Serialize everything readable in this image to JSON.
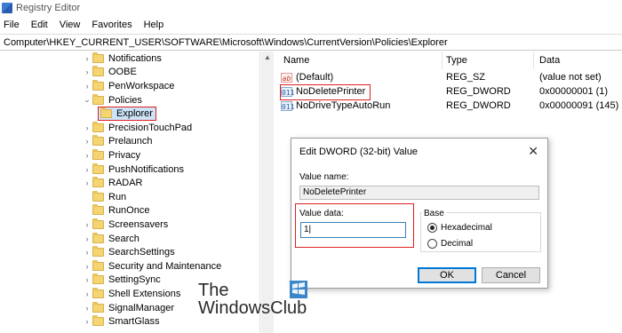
{
  "window": {
    "title": "Registry Editor"
  },
  "menu": [
    "File",
    "Edit",
    "View",
    "Favorites",
    "Help"
  ],
  "address": "Computer\\HKEY_CURRENT_USER\\SOFTWARE\\Microsoft\\Windows\\CurrentVersion\\Policies\\Explorer",
  "tree": {
    "items": [
      {
        "label": "Notifications",
        "chevron": "›"
      },
      {
        "label": "OOBE",
        "chevron": "›"
      },
      {
        "label": "PenWorkspace",
        "chevron": "›"
      },
      {
        "label": "Policies",
        "chevron": "⌄"
      },
      {
        "label": "Explorer",
        "chevron": ""
      },
      {
        "label": "PrecisionTouchPad",
        "chevron": "›"
      },
      {
        "label": "Prelaunch",
        "chevron": "›"
      },
      {
        "label": "Privacy",
        "chevron": "›"
      },
      {
        "label": "PushNotifications",
        "chevron": "›"
      },
      {
        "label": "RADAR",
        "chevron": "›"
      },
      {
        "label": "Run",
        "chevron": ""
      },
      {
        "label": "RunOnce",
        "chevron": ""
      },
      {
        "label": "Screensavers",
        "chevron": "›"
      },
      {
        "label": "Search",
        "chevron": "›"
      },
      {
        "label": "SearchSettings",
        "chevron": "›"
      },
      {
        "label": "Security and Maintenance",
        "chevron": "›"
      },
      {
        "label": "SettingSync",
        "chevron": "›"
      },
      {
        "label": "Shell Extensions",
        "chevron": "›"
      },
      {
        "label": "SignalManager",
        "chevron": "›"
      },
      {
        "label": "SmartGlass",
        "chevron": "›"
      }
    ]
  },
  "list": {
    "headers": {
      "name": "Name",
      "type": "Type",
      "data": "Data"
    },
    "rows": [
      {
        "icon": "ab",
        "name": "(Default)",
        "type": "REG_SZ",
        "data": "(value not set)"
      },
      {
        "icon": "011",
        "name": "NoDeletePrinter",
        "type": "REG_DWORD",
        "data": "0x00000001 (1)"
      },
      {
        "icon": "011",
        "name": "NoDriveTypeAutoRun",
        "type": "REG_DWORD",
        "data": "0x00000091 (145)"
      }
    ]
  },
  "dialog": {
    "title": "Edit DWORD (32-bit) Value",
    "close": "✕",
    "value_name_label": "Value name:",
    "value_name": "NoDeletePrinter",
    "value_data_label": "Value data:",
    "value_data": "1|",
    "base_label": "Base",
    "hex_label": "Hexadecimal",
    "dec_label": "Decimal",
    "ok": "OK",
    "cancel": "Cancel"
  },
  "watermark": {
    "line1": "The",
    "line2": "WindowsClub"
  }
}
